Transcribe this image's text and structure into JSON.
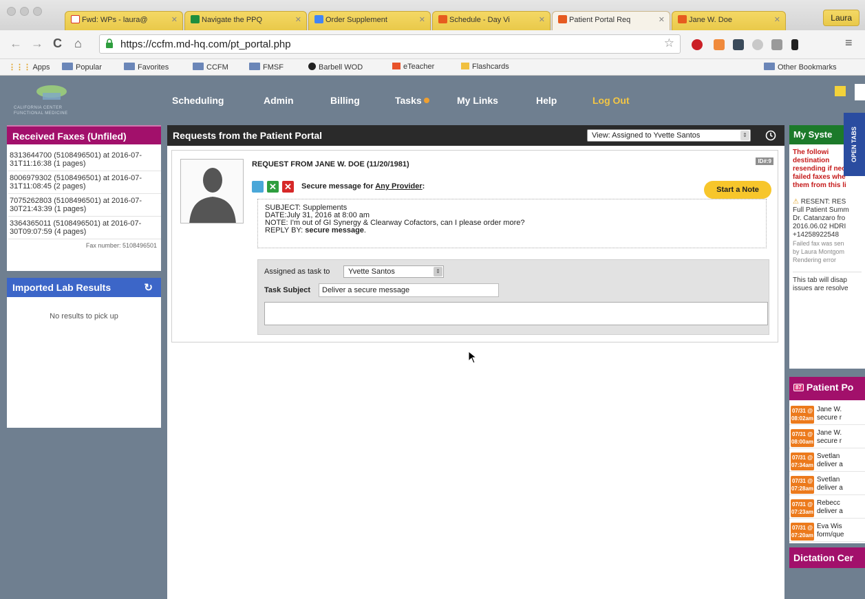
{
  "browser": {
    "tabs": [
      {
        "title": "Fwd: WPs - laura@",
        "favicon": "gmail",
        "color": "#d93025"
      },
      {
        "title": "Navigate the PPQ",
        "favicon": "drive",
        "color": "#1e8e3e"
      },
      {
        "title": "Order Supplement",
        "favicon": "doc",
        "color": "#4285f4"
      },
      {
        "title": "Schedule - Day Vi",
        "favicon": "cross",
        "color": "#e65b1f"
      },
      {
        "title": "Patient Portal Req",
        "favicon": "cross",
        "color": "#e65b1f",
        "active": true
      },
      {
        "title": "Jane W. Doe",
        "favicon": "cross",
        "color": "#e65b1f"
      }
    ],
    "user": "Laura",
    "url": "https://ccfm.md-hq.com/pt_portal.php",
    "bookmarks": [
      "Apps",
      "Popular",
      "Favorites",
      "CCFM",
      "FMSF",
      "Barbell WOD",
      "eTeacher",
      "Flashcards"
    ],
    "other_bookmarks": "Other Bookmarks"
  },
  "nav": {
    "items": [
      "Scheduling",
      "Admin",
      "Billing",
      "Tasks",
      "My Links",
      "Help"
    ],
    "logout": "Log Out"
  },
  "faxes": {
    "title": "Received Faxes (Unfiled)",
    "items": [
      "8313644700 (5108496501) at 2016-07-31T11:16:38 (1 pages)",
      "8006979302 (5108496501) at 2016-07-31T11:08:45 (2 pages)",
      "7075262803 (5108496501) at 2016-07-30T21:43:39 (1 pages)",
      "3364365011 (5108496501) at 2016-07-30T09:07:59 (4 pages)"
    ],
    "fax_number": "Fax number: 5108496501"
  },
  "labs": {
    "title": "Imported Lab Results",
    "empty": "No results to pick up"
  },
  "portal": {
    "title": "Requests from the Patient Portal",
    "view": "View: Assigned to Yvette Santos",
    "request_title": "REQUEST FROM JANE W. DOE (11/20/1981)",
    "id_badge": "ID#:9",
    "secure_prefix": "Secure message for ",
    "provider": "Any Provider",
    "secure_suffix": ":",
    "start_note": "Start a Note",
    "subject": "SUBJECT: Supplements",
    "date": "DATE:July 31, 2016 at 8:00 am",
    "note": "NOTE: I'm out of GI Synergy & Clearway Cofactors, can I please order more?",
    "reply_prefix": "REPLY BY: ",
    "reply_value": "secure message",
    "reply_suffix": ".",
    "assigned_label": "Assigned as task to",
    "assigned_value": "Yvette Santos",
    "subject_label": "Task Subject",
    "subject_value": "Deliver a secure message"
  },
  "system": {
    "title": "My Syste",
    "warning_lines": [
      "The followi",
      "destination",
      "resending if nec",
      "failed faxes whe",
      "them from this li"
    ],
    "resent_title": "RESENT: RES",
    "resent_lines": [
      "Full Patient Summ",
      "Dr. Catanzaro fro",
      "2016.06.02 HDRI",
      "+14258922548"
    ],
    "resent_small": [
      "Failed fax was sen",
      "by Laura Montgom",
      "Rendering error"
    ],
    "footer_lines": [
      "This tab will disap",
      "issues are resolve"
    ],
    "open_tabs": "OPEN TABS"
  },
  "patient_portal": {
    "title": "Patient Po",
    "badge": "87",
    "items": [
      {
        "time_a": "07/31 @",
        "time_b": "08:02am",
        "line1": "Jane W.",
        "line2": "secure r"
      },
      {
        "time_a": "07/31 @",
        "time_b": "08:00am",
        "line1": "Jane W.",
        "line2": "secure r"
      },
      {
        "time_a": "07/31 @",
        "time_b": "07:34am",
        "line1": "Svetlan",
        "line2": "deliver a"
      },
      {
        "time_a": "07/31 @",
        "time_b": "07:28am",
        "line1": "Svetlan",
        "line2": "deliver a"
      },
      {
        "time_a": "07/31 @",
        "time_b": "07:23am",
        "line1": "Rebecc",
        "line2": "deliver a"
      },
      {
        "time_a": "07/31 @",
        "time_b": "07:20am",
        "line1": "Eva Wis",
        "line2": "form/que"
      }
    ]
  },
  "dictation": {
    "title": "Dictation Cer"
  },
  "logo": {
    "text": "CALIFORNIA CENTER FUNCTIONAL MEDICINE"
  }
}
